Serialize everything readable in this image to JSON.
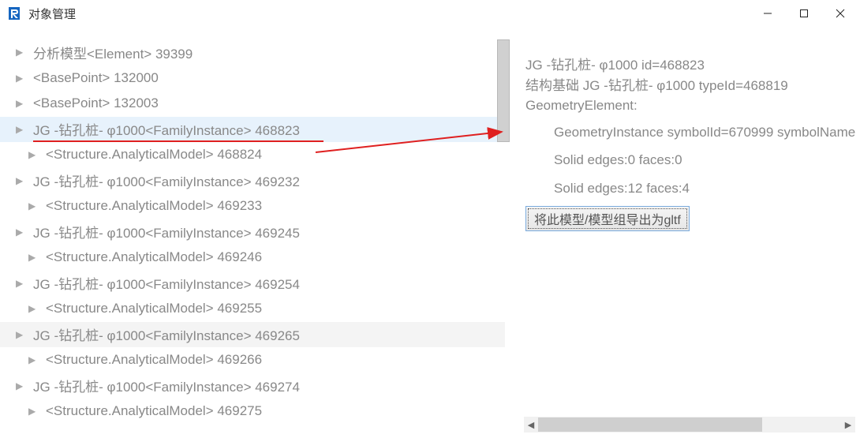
{
  "window": {
    "title": "对象管理"
  },
  "tree": {
    "items": [
      {
        "label": "分析模型<Element> 39399",
        "indent": 1,
        "selected": false,
        "hover": false
      },
      {
        "label": "<BasePoint> 132000",
        "indent": 1,
        "selected": false,
        "hover": false
      },
      {
        "label": "<BasePoint> 132003",
        "indent": 1,
        "selected": false,
        "hover": false
      },
      {
        "label": "JG -钻孔桩- φ1000<FamilyInstance> 468823",
        "indent": 1,
        "selected": true,
        "hover": false
      },
      {
        "label": "<Structure.AnalyticalModel> 468824",
        "indent": 2,
        "selected": false,
        "hover": false
      },
      {
        "label": "JG -钻孔桩- φ1000<FamilyInstance> 469232",
        "indent": 1,
        "selected": false,
        "hover": false
      },
      {
        "label": "<Structure.AnalyticalModel> 469233",
        "indent": 2,
        "selected": false,
        "hover": false
      },
      {
        "label": "JG -钻孔桩- φ1000<FamilyInstance> 469245",
        "indent": 1,
        "selected": false,
        "hover": false
      },
      {
        "label": "<Structure.AnalyticalModel> 469246",
        "indent": 2,
        "selected": false,
        "hover": false
      },
      {
        "label": "JG -钻孔桩- φ1000<FamilyInstance> 469254",
        "indent": 1,
        "selected": false,
        "hover": false
      },
      {
        "label": "<Structure.AnalyticalModel> 469255",
        "indent": 2,
        "selected": false,
        "hover": false
      },
      {
        "label": "JG -钻孔桩- φ1000<FamilyInstance> 469265",
        "indent": 1,
        "selected": false,
        "hover": true
      },
      {
        "label": "<Structure.AnalyticalModel> 469266",
        "indent": 2,
        "selected": false,
        "hover": false
      },
      {
        "label": "JG -钻孔桩- φ1000<FamilyInstance> 469274",
        "indent": 1,
        "selected": false,
        "hover": false
      },
      {
        "label": "<Structure.AnalyticalModel> 469275",
        "indent": 2,
        "selected": false,
        "hover": false
      }
    ]
  },
  "details": {
    "line1": "JG -钻孔桩- φ1000 id=468823",
    "line2": "结构基础 JG -钻孔桩- φ1000 typeId=468819",
    "line3": "GeometryElement:",
    "line4": "GeometryInstance symbolId=670999 symbolName",
    "line5": "Solid edges:0 faces:0",
    "line6": "Solid edges:12 faces:4",
    "export_button": "将此模型/模型组导出为gltf"
  }
}
